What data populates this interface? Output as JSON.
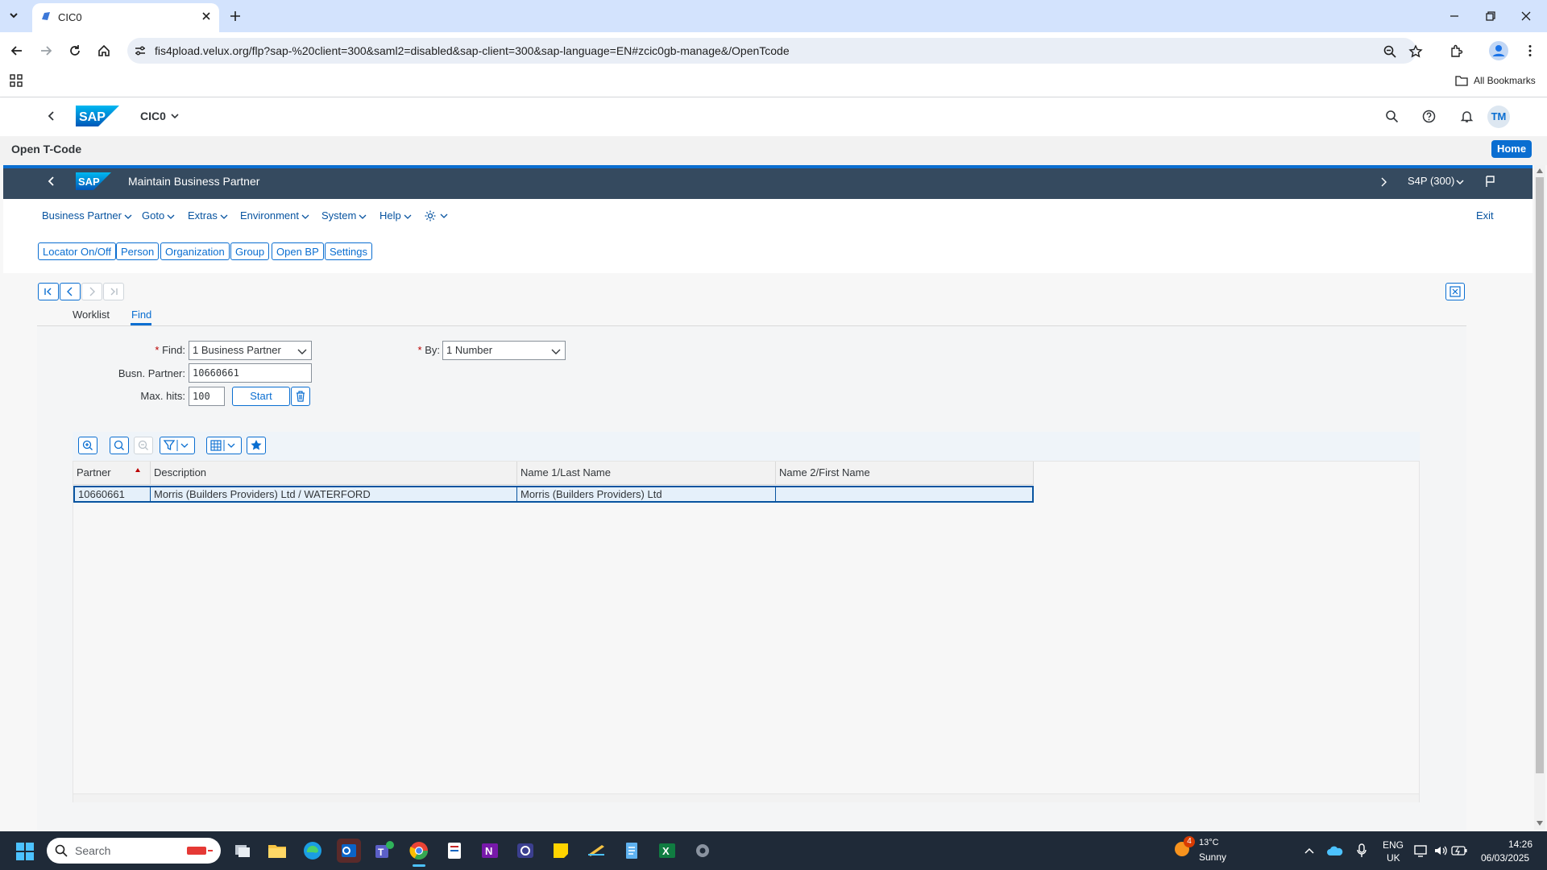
{
  "browser": {
    "tab_title": "CIC0",
    "url": "fis4pload.velux.org/flp?sap-%20client=300&saml2=disabled&sap-client=300&sap-language=EN#zcic0gb-manage&/OpenTcode",
    "bookmarks_label": "All Bookmarks"
  },
  "shell": {
    "logo_text": "SAP",
    "app_title": "CIC0",
    "avatar_initials": "TM",
    "subheader_title": "Open T-Code",
    "home_button": "Home"
  },
  "sap_window": {
    "title": "Maintain Business Partner",
    "system": "S4P (300)",
    "menu": [
      "Business Partner",
      "Goto",
      "Extras",
      "Environment",
      "System",
      "Help"
    ],
    "exit_label": "Exit",
    "toolbar_buttons": [
      "Locator On/Off",
      "Person",
      "Organization",
      "Group",
      "Open BP",
      "Settings"
    ]
  },
  "locator": {
    "tabs": [
      "Worklist",
      "Find"
    ],
    "active_tab": "Find",
    "find_label": "Find:",
    "find_value": "1 Business Partner",
    "by_label": "By:",
    "by_value": "1 Number",
    "busn_partner_label": "Busn. Partner:",
    "busn_partner_value": "10660661",
    "max_hits_label": "Max. hits:",
    "max_hits_value": "100",
    "start_button": "Start"
  },
  "results": {
    "columns": [
      "Partner",
      "Description",
      "Name 1/Last Name",
      "Name 2/First Name"
    ],
    "rows": [
      [
        "10660661",
        "Morris (Builders Providers) Ltd / WATERFORD",
        "Morris (Builders Providers) Ltd",
        ""
      ]
    ]
  },
  "taskbar": {
    "search_placeholder": "Search",
    "weather_temp": "13°C",
    "weather_text": "Sunny",
    "weather_badge": "4",
    "lang_top": "ENG",
    "lang_bottom": "UK",
    "time": "14:26",
    "date": "06/03/2025"
  }
}
